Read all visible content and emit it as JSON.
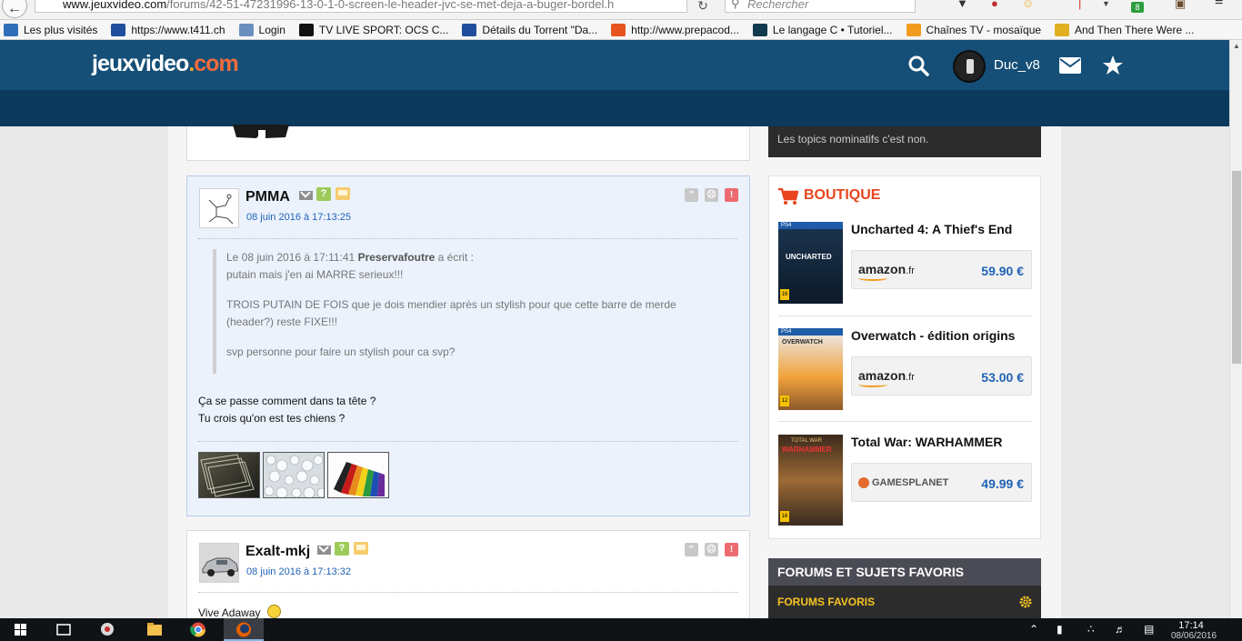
{
  "browser": {
    "url_domain": "www.jeuxvideo.com",
    "url_path": "/forums/42-51-47231996-13-0-1-0-screen-le-header-jvc-se-met-deja-a-buger-bordel.h",
    "search_placeholder": "Rechercher",
    "bookmarks": [
      {
        "label": "Les plus visités",
        "icon": "bookmark-star-icon",
        "color": "#2f6fba"
      },
      {
        "label": "https://www.t411.ch",
        "icon": "t411-icon",
        "color": "#1f4e9c"
      },
      {
        "label": "Login",
        "icon": "login-icon",
        "color": "#6a8fbf"
      },
      {
        "label": "TV LIVE SPORT: OCS C...",
        "icon": "tv-icon",
        "color": "#111111"
      },
      {
        "label": "Détails du Torrent \"Da...",
        "icon": "t411-icon",
        "color": "#1f4e9c"
      },
      {
        "label": "http://www.prepacod...",
        "icon": "prepacode-icon",
        "color": "#e8541e"
      },
      {
        "label": "Le langage C • Tutoriel...",
        "icon": "oc-icon",
        "color": "#123a4e"
      },
      {
        "label": "Chaînes TV - mosaïque",
        "icon": "chaines-icon",
        "color": "#f29c1f"
      },
      {
        "label": "And Then There Were ...",
        "icon": "attw-icon",
        "color": "#e0b020"
      }
    ],
    "toolbar_badge": "8"
  },
  "header": {
    "logo_prefix": "jeuxvideo",
    "logo_dot": ".",
    "logo_suffix": "com",
    "username": "Duc_v8"
  },
  "posts": [
    {
      "author": "PMMA",
      "date": "08 juin 2016 à 17:13:25",
      "quote": {
        "header_prefix": "Le 08 juin 2016 à 17:11:41 ",
        "quoted_author": "Preservafoutre",
        "header_suffix": " a écrit :",
        "lines": [
          "putain mais j'en ai MARRE serieux!!!",
          "TROIS PUTAIN DE FOIS que je dois mendier après un stylish pour que cette barre de merde (header?) reste FIXE!!!",
          "svp personne pour faire un stylish pour ca svp?"
        ]
      },
      "message": [
        "Ça se passe comment dans ta tête ?",
        "Tu crois qu'on est tes chiens ?"
      ]
    },
    {
      "author": "Exalt-mkj",
      "date": "08 juin 2016 à 17:13:32",
      "message": [
        "Vive Adaway"
      ]
    }
  ],
  "sidebar": {
    "dark_text": "Les topics nominatifs c'est non.",
    "boutique_title": "BOUTIQUE",
    "products": [
      {
        "name": "Uncharted 4: A Thief's End",
        "store": "amazon",
        "store_tld": ".fr",
        "price": "59.90 €",
        "cover_badge": "PS4",
        "cover_title": "UNCHARTED",
        "cover_age": "16"
      },
      {
        "name": "Overwatch - édition origins",
        "store": "amazon",
        "store_tld": ".fr",
        "price": "53.00 €",
        "cover_badge": "PS4",
        "cover_title": "OVERWATCH",
        "cover_age": "12"
      },
      {
        "name": "Total War: WARHAMMER",
        "store": "GAMESPLANET",
        "store_tld": "",
        "price": "49.99 €",
        "cover_badge": "TOTAL WAR",
        "cover_title": "WARHAMMER",
        "cover_age": "16"
      }
    ],
    "forums_title": "FORUMS ET SUJETS FAVORIS",
    "forums_sub": "FORUMS FAVORIS"
  },
  "taskbar": {
    "time": "17:14",
    "date": "08/06/2016"
  },
  "colors": {
    "header_top": "#154f77",
    "header_bottom": "#0c3a5c",
    "accent_orange": "#e8451e",
    "link_blue": "#1f62b6",
    "forum_yellow": "#f5c424"
  }
}
